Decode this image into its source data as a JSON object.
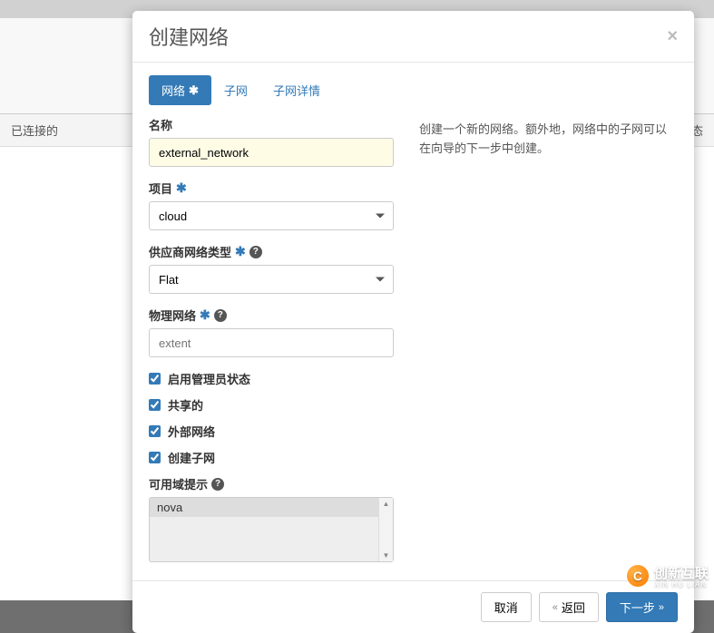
{
  "background": {
    "left_label": "已连接的",
    "right_label": "状态"
  },
  "modal": {
    "title": "创建网络",
    "close": "×",
    "tabs": [
      {
        "label": "网络",
        "required": true,
        "active": true
      },
      {
        "label": "子网",
        "required": false,
        "active": false
      },
      {
        "label": "子网详情",
        "required": false,
        "active": false
      }
    ],
    "description": "创建一个新的网络。额外地，网络中的子网可以在向导的下一步中创建。",
    "form": {
      "name_label": "名称",
      "name_value": "external_network",
      "project_label": "项目",
      "project_value": "cloud",
      "provider_type_label": "供应商网络类型",
      "provider_type_value": "Flat",
      "physical_network_label": "物理网络",
      "physical_network_placeholder": "extent",
      "admin_state_label": "启用管理员状态",
      "admin_state_checked": true,
      "shared_label": "共享的",
      "shared_checked": true,
      "external_label": "外部网络",
      "external_checked": true,
      "create_subnet_label": "创建子网",
      "create_subnet_checked": true,
      "availability_label": "可用域提示",
      "availability_options": [
        "nova"
      ]
    },
    "footer": {
      "cancel": "取消",
      "back": "返回",
      "next": "下一步"
    }
  },
  "watermark": {
    "text": "创新互联",
    "sub": "XIN HU LIAN"
  }
}
